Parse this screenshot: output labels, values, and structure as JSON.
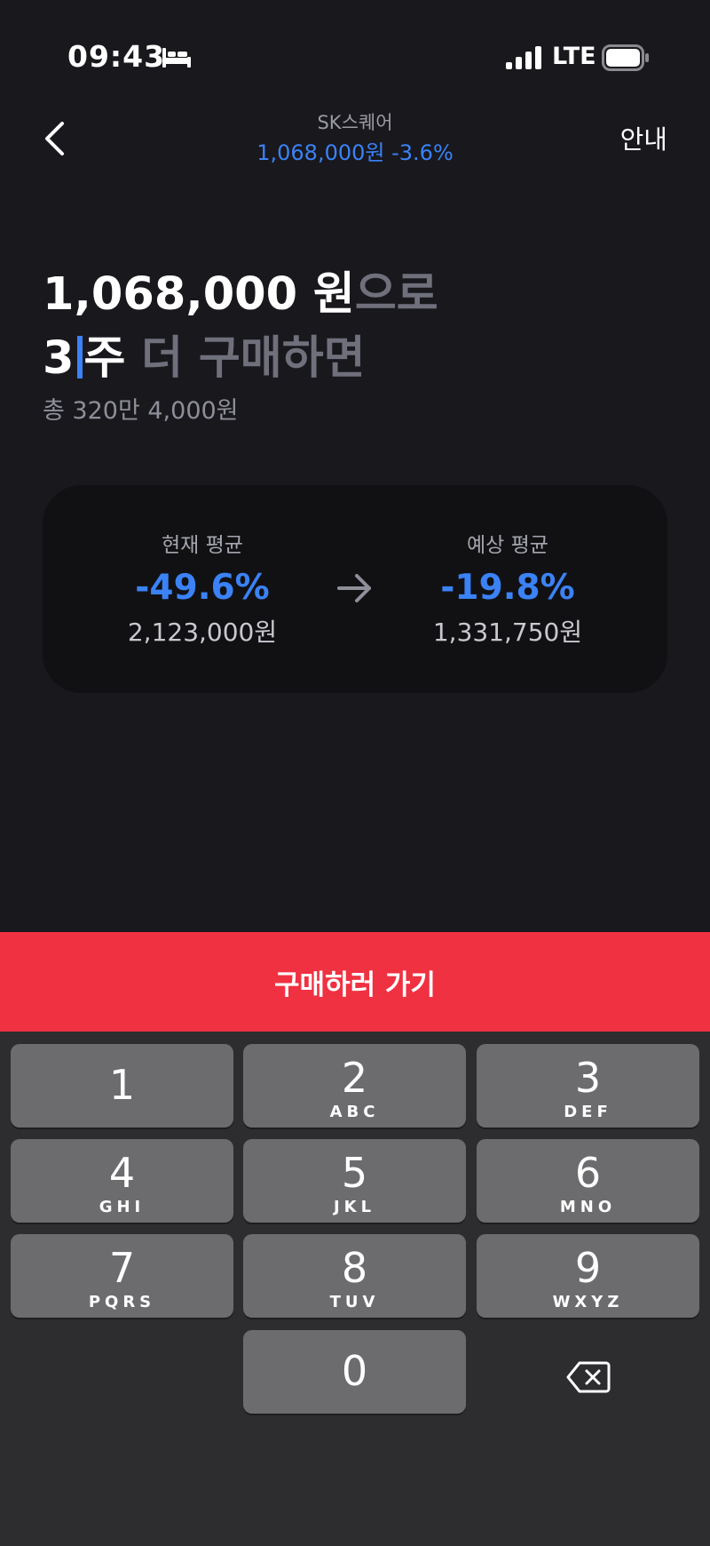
{
  "status": {
    "time": "09:43",
    "network": "LTE",
    "icons": [
      "bed-icon",
      "signal-icon",
      "battery-icon"
    ]
  },
  "header": {
    "stock_name": "SK스퀘어",
    "price": "1,068,000원",
    "change": "-3.6%",
    "guide_label": "안내"
  },
  "headline": {
    "price": "1,068,000 원",
    "price_suffix": "으로",
    "quantity": "3",
    "unit": "주",
    "rest": " 더 구매하면"
  },
  "total": "총 320만 4,000원",
  "compare": {
    "current_label": "현재 평균",
    "current_pct": "-49.6%",
    "current_amount": "2,123,000원",
    "expected_label": "예상 평균",
    "expected_pct": "-19.8%",
    "expected_amount": "1,331,750원"
  },
  "buy_button": "구매하러 가기",
  "keypad": {
    "keys": [
      {
        "num": "1",
        "letters": ""
      },
      {
        "num": "2",
        "letters": "ABC"
      },
      {
        "num": "3",
        "letters": "DEF"
      },
      {
        "num": "4",
        "letters": "GHI"
      },
      {
        "num": "5",
        "letters": "JKL"
      },
      {
        "num": "6",
        "letters": "MNO"
      },
      {
        "num": "7",
        "letters": "PQRS"
      },
      {
        "num": "8",
        "letters": "TUV"
      },
      {
        "num": "9",
        "letters": "WXYZ"
      },
      {
        "num": "0",
        "letters": ""
      }
    ]
  },
  "colors": {
    "background": "#18181d",
    "accent_blue": "#3b82f6",
    "buy_red": "#f03141",
    "card": "#111114",
    "keypad_bg": "#2d2d30",
    "key": "#6c6c6e"
  }
}
